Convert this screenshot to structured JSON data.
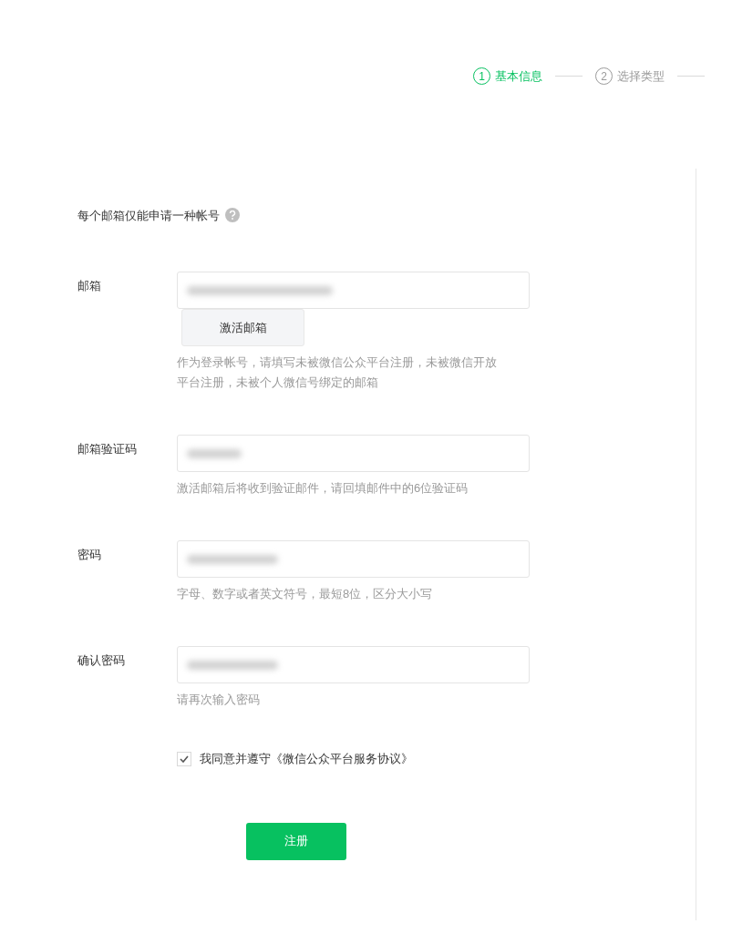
{
  "steps": [
    {
      "number": "1",
      "label": "基本信息",
      "selected": true
    },
    {
      "number": "2",
      "label": "选择类型",
      "selected": false
    }
  ],
  "note": {
    "text": "每个邮箱仅能申请一种帐号"
  },
  "fields": [
    {
      "kind": "email",
      "label": "邮箱",
      "obscured": true,
      "button": "激活邮箱",
      "hint": "作为登录帐号，请填写未被微信公众平台注册，未被微信开放平台注册，未被个人微信号绑定的邮箱"
    },
    {
      "kind": "code",
      "label": "邮箱验证码",
      "obscured": true,
      "hint": "激活邮箱后将收到验证邮件，请回填邮件中的6位验证码"
    },
    {
      "kind": "password",
      "label": "密码",
      "obscured": true,
      "hint": "字母、数字或者英文符号，最短8位，区分大小写"
    },
    {
      "kind": "password",
      "label": "确认密码",
      "obscured": true,
      "hint": "请再次输入密码"
    }
  ],
  "agreement": {
    "checked": true,
    "text": "我同意并遵守《微信公众平台服务协议》"
  },
  "submit": "注册"
}
